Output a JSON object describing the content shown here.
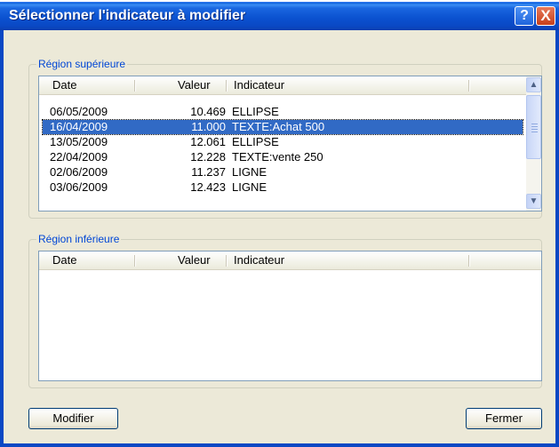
{
  "window": {
    "title": "Sélectionner l'indicateur à modifier",
    "help_glyph": "?",
    "close_glyph": "X"
  },
  "upper": {
    "label": "Région supérieure",
    "columns": {
      "date": "Date",
      "value": "Valeur",
      "indicator": "Indicateur"
    },
    "rows": [
      {
        "date": "06/05/2009",
        "value": "10.469",
        "indicator": "ELLIPSE",
        "selected": false
      },
      {
        "date": "16/04/2009",
        "value": "11.000",
        "indicator": "TEXTE:Achat 500",
        "selected": true
      },
      {
        "date": "13/05/2009",
        "value": "12.061",
        "indicator": "ELLIPSE",
        "selected": false
      },
      {
        "date": "22/04/2009",
        "value": "12.228",
        "indicator": "TEXTE:vente 250",
        "selected": false
      },
      {
        "date": "02/06/2009",
        "value": "11.237",
        "indicator": "LIGNE",
        "selected": false
      },
      {
        "date": "03/06/2009",
        "value": "12.423",
        "indicator": "LIGNE",
        "selected": false
      }
    ],
    "scroll_up_glyph": "▲",
    "scroll_down_glyph": "▼"
  },
  "lower": {
    "label": "Région inférieure",
    "columns": {
      "date": "Date",
      "value": "Valeur",
      "indicator": "Indicateur"
    },
    "rows": []
  },
  "buttons": {
    "modify": "Modifier",
    "close": "Fermer"
  },
  "colors": {
    "selection": "#316ac5",
    "group_label": "#0046d5",
    "dialog_bg": "#ece9d8"
  }
}
